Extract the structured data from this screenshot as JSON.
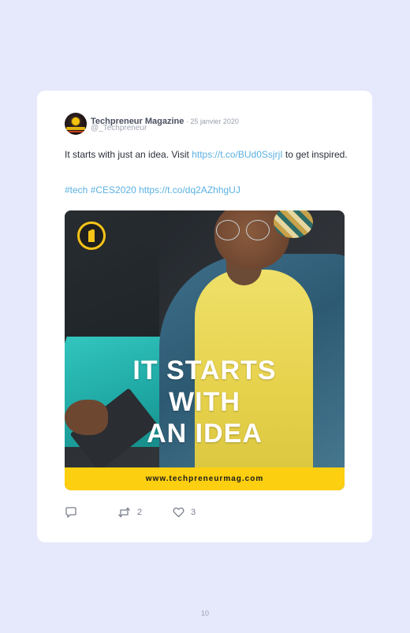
{
  "tweet": {
    "author_name": "Techpreneur Magazine",
    "separator": " · ",
    "date": "25 janvier 2020",
    "handle": "@_Techpreneur",
    "text_before_link": "It starts with just an idea. Visit ",
    "link1": "https://t.co/BUd0SsjrjI",
    "text_after_link": " to get inspired.",
    "hashtag1": "#tech",
    "hashtag2": "#CES2020",
    "link2": "https://t.co/dq2AZhhgUJ"
  },
  "media": {
    "headline_line1": "IT STARTS",
    "headline_line2": "WITH",
    "headline_line3": "AN IDEA",
    "banner_url": "www.techpreneurmag.com"
  },
  "actions": {
    "reply_icon": "reply-icon",
    "retweet_icon": "retweet-icon",
    "retweet_count": "2",
    "like_icon": "heart-icon",
    "like_count": "3"
  },
  "page": {
    "number": "10"
  },
  "colors": {
    "background": "#e6e8fb",
    "link": "#5bb1e2",
    "banner": "#fccf10"
  }
}
